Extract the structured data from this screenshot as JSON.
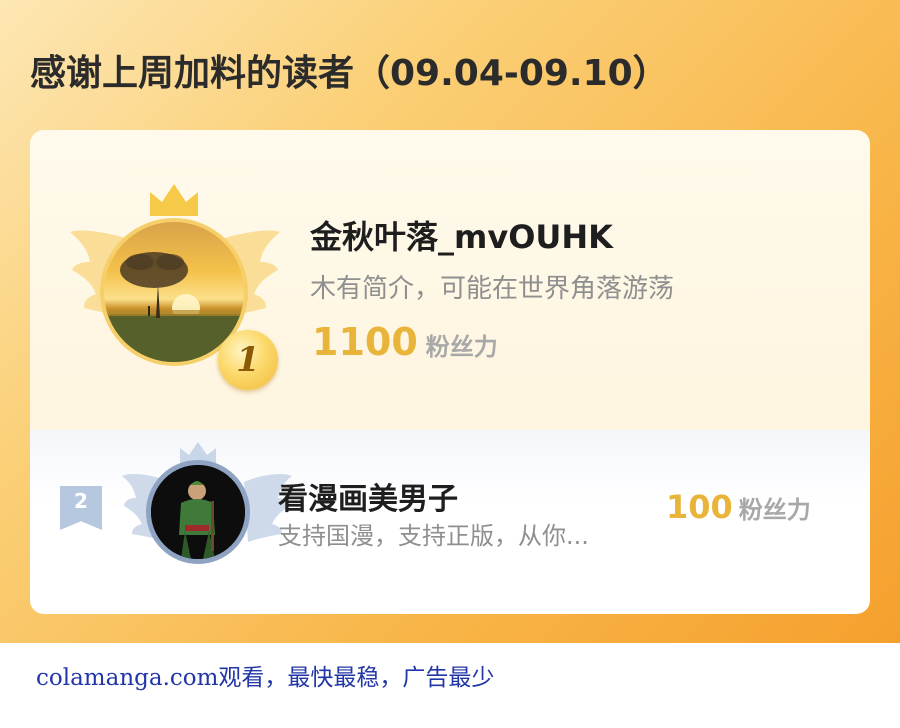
{
  "header": {
    "title": "感谢上周加料的读者（09.04-09.10）"
  },
  "colors": {
    "banner_gradient_start": "#fde7b4",
    "banner_gradient_end": "#f5a02e",
    "fans_number": "#e9b43a",
    "rank2_badge": "#b6c8df",
    "watermark": "#2236a8"
  },
  "ranking": [
    {
      "rank": "1",
      "name": "金秋叶落_mvOUHK",
      "bio": "木有简介，可能在世界角落游荡",
      "fans_value": "1100",
      "fans_unit": "粉丝力",
      "avatar_icon": "sunset-tree-avatar",
      "badge_icon": "gold-medal-icon"
    },
    {
      "rank": "2",
      "name": "看漫画美男子",
      "bio": "支持国漫，支持正版，从你...",
      "fans_value": "100",
      "fans_unit": "粉丝力",
      "avatar_icon": "anime-swordsman-avatar",
      "badge_icon": "silver-ribbon-icon"
    }
  ],
  "footer": {
    "watermark": "colamanga.com观看，最快最稳，广告最少"
  }
}
